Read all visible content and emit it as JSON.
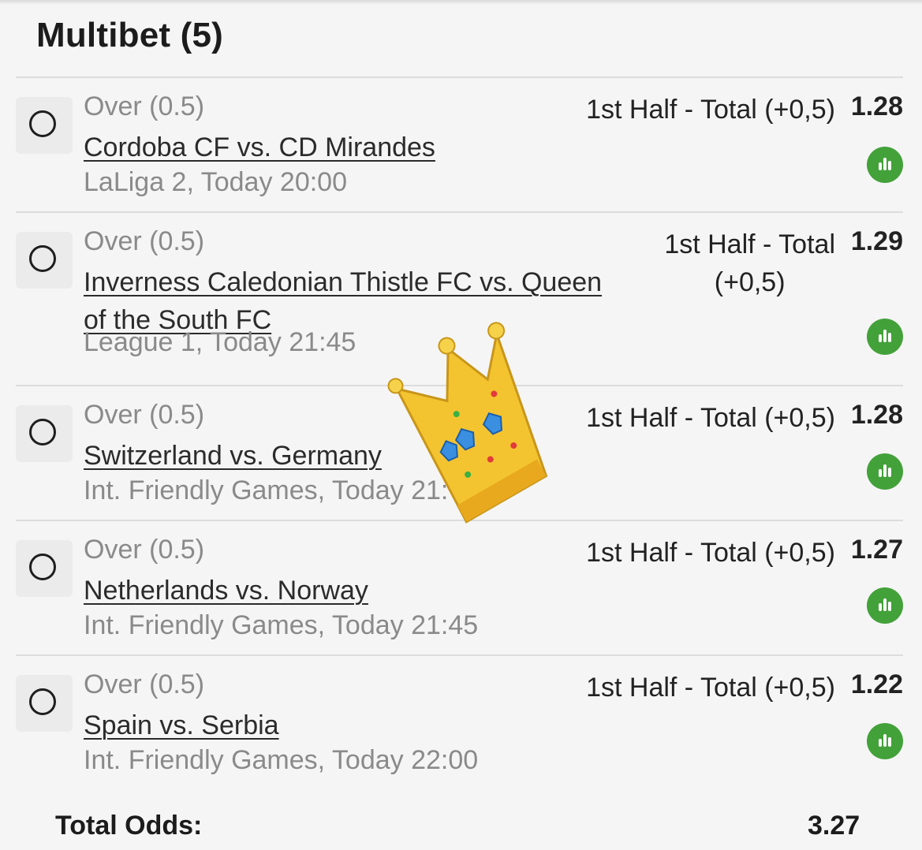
{
  "header": {
    "title": "Multibet (5)"
  },
  "bets": [
    {
      "selection": "Over (0.5)",
      "match": "Cordoba CF vs. CD Mirandes",
      "league": "LaLiga 2, Today 20:00",
      "market": "1st Half - Total (+0,5)",
      "odds": "1.28",
      "stats_icon": "bar-chart-icon"
    },
    {
      "selection": "Over (0.5)",
      "match_line1": "Inverness Caledonian Thistle FC vs. Queen",
      "match_line2": "of the South FC",
      "league": "League 1, Today 21:45",
      "market_line1": "1st Half - Total",
      "market_line2": "(+0,5)",
      "odds": "1.29",
      "stats_icon": "bar-chart-icon"
    },
    {
      "selection": "Over (0.5)",
      "match": "Switzerland vs. Germany",
      "league": "Int. Friendly Games, Today 21:",
      "market": "1st Half - Total (+0,5)",
      "odds": "1.28",
      "stats_icon": "bar-chart-icon"
    },
    {
      "selection": "Over (0.5)",
      "match": "Netherlands vs. Norway",
      "league": "Int. Friendly Games, Today 21:45",
      "market": "1st Half - Total (+0,5)",
      "odds": "1.27",
      "stats_icon": "bar-chart-icon"
    },
    {
      "selection": "Over (0.5)",
      "match": "Spain vs. Serbia",
      "league": "Int. Friendly Games, Today 22:00",
      "market": "1st Half - Total (+0,5)",
      "odds": "1.22",
      "stats_icon": "bar-chart-icon"
    }
  ],
  "footer": {
    "total_label": "Total Odds:",
    "total_value": "3.27"
  },
  "overlay": {
    "sticker": "crown-emoji"
  },
  "colors": {
    "stats_green": "#43a13a",
    "muted_text": "#8a8a8a",
    "divider": "#dcdcdc"
  }
}
